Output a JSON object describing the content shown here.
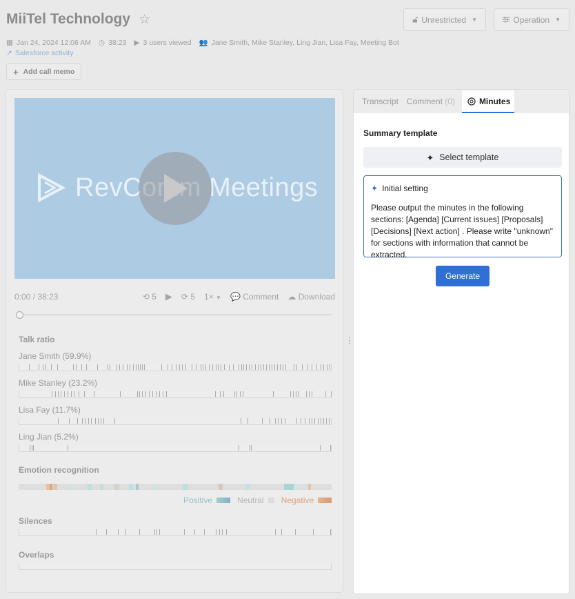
{
  "header": {
    "title": "MiiTel Technology",
    "access_label": "Unrestricted",
    "operation_label": "Operation",
    "meta": {
      "datetime": "Jan 24, 2024 12:06 AM",
      "duration": "38:23",
      "views": "3 users viewed",
      "participants": "Jane Smith, Mike Stanley, Ling Jian, Lisa Fay, Meeting Bot"
    },
    "salesforce_link": "Salesforce activity",
    "add_memo_label": "Add call memo"
  },
  "player": {
    "logo_text": "RevComm Meetings",
    "time": "0:00 / 38:23",
    "rewind_label": "5",
    "forward_label": "5",
    "speed": "1×",
    "comment_label": "Comment",
    "download_label": "Download",
    "progress": 0
  },
  "analytics": {
    "talk_ratio_title": "Talk ratio",
    "speakers": [
      {
        "label": "Jane Smith (59.9%)"
      },
      {
        "label": "Mike Stanley (23.2%)"
      },
      {
        "label": "Lisa Fay (11.7%)"
      },
      {
        "label": "Ling Jian (5.2%)"
      }
    ],
    "emotion_title": "Emotion recognition",
    "legend": {
      "positive": "Positive",
      "neutral": "Neutral",
      "negative": "Negative"
    },
    "silences_title": "Silences",
    "overlaps_title": "Overlaps"
  },
  "side": {
    "tabs": {
      "transcript": "Transcript",
      "comment": "Comment",
      "comment_count": "(0)",
      "minutes": "Minutes"
    },
    "summary_label": "Summary template",
    "select_template_label": "Select template",
    "initial_setting_label": "Initial setting",
    "initial_text": "Please output the minutes in the following sections: [Agenda] [Current issues] [Proposals] [Decisions] [Next action] . Please write \"unknown\" for sections with information that cannot be extracted.",
    "generate_label": "Generate"
  },
  "colors": {
    "accent": "#2f6fd6",
    "positive": "#8fc4c4",
    "negative": "#e0a37a",
    "neutral": "#dcdcdc"
  }
}
